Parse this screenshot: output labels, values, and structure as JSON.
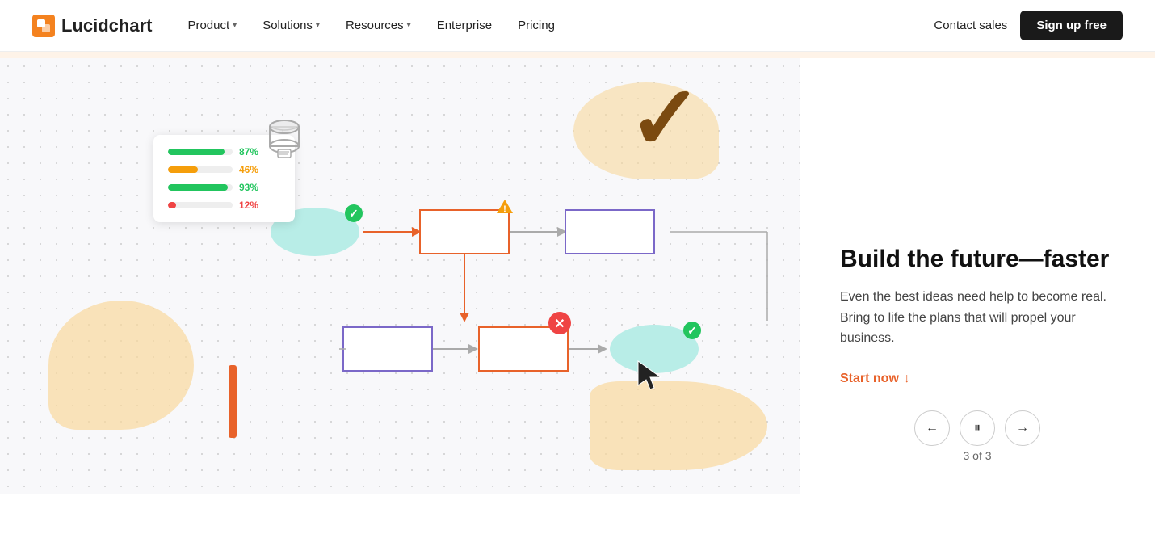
{
  "navbar": {
    "logo_text": "Lucidchart",
    "nav_items": [
      {
        "label": "Product",
        "has_dropdown": true
      },
      {
        "label": "Solutions",
        "has_dropdown": true
      },
      {
        "label": "Resources",
        "has_dropdown": true
      },
      {
        "label": "Enterprise",
        "has_dropdown": false
      },
      {
        "label": "Pricing",
        "has_dropdown": false
      }
    ],
    "contact_sales": "Contact sales",
    "sign_up": "Sign up free"
  },
  "slide": {
    "title": "Build the future—faster",
    "description": "Even the best ideas need help to become real. Bring to life the plans that will propel your business.",
    "cta": "Start now",
    "counter": "3 of 3"
  },
  "data_widget": {
    "rows": [
      {
        "color": "#22c55e",
        "pct": 87,
        "label": "87%"
      },
      {
        "color": "#f59e0b",
        "pct": 46,
        "label": "46%"
      },
      {
        "color": "#22c55e",
        "pct": 93,
        "label": "93%"
      },
      {
        "color": "#ef4444",
        "pct": 12,
        "label": "12%"
      }
    ]
  },
  "controls": {
    "prev": "←",
    "pause": "⏸",
    "next": "→"
  },
  "colors": {
    "accent": "#e8622a",
    "checkmark": "#7b4a10",
    "blob": "#f9d89c"
  }
}
